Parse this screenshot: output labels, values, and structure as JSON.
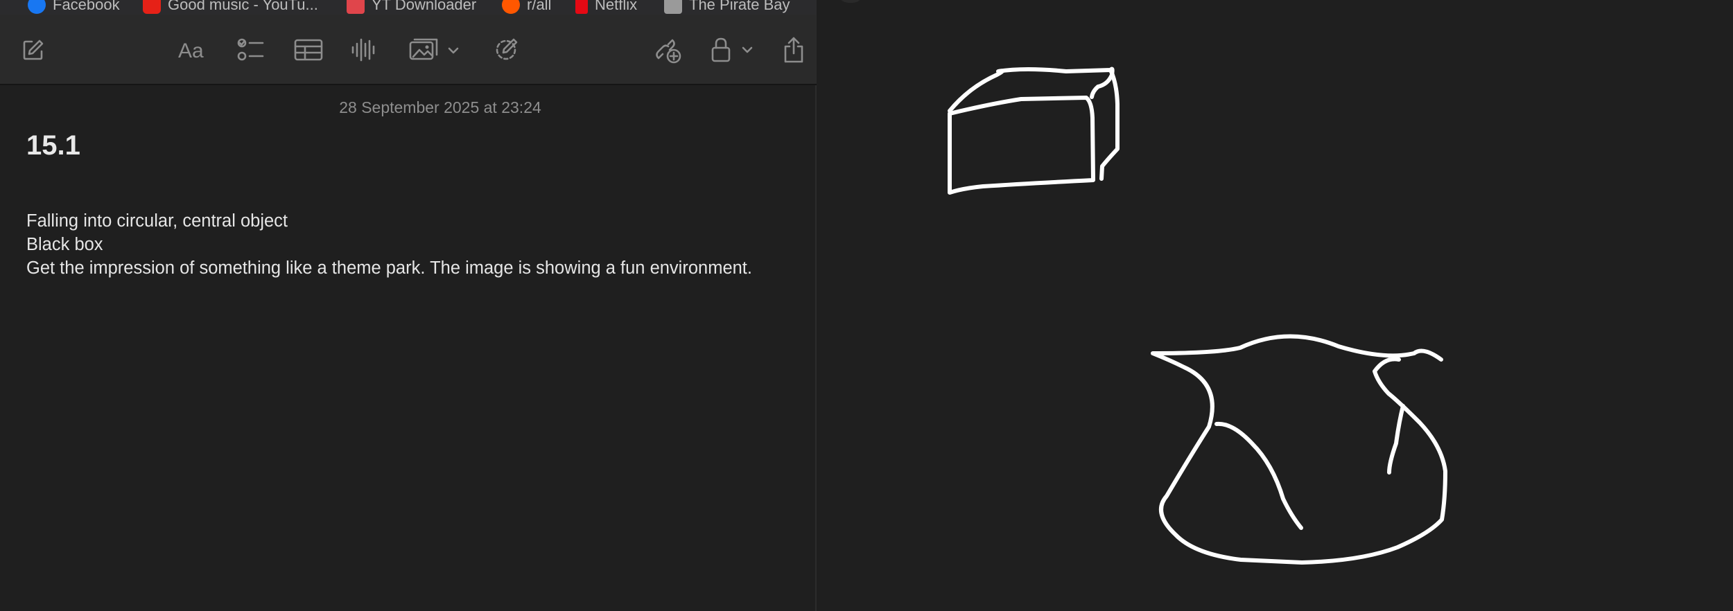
{
  "bookmarks": [
    {
      "label": "Facebook",
      "icon": "facebook-icon",
      "color": "#1877f2"
    },
    {
      "label": "Good music - YouTu...",
      "icon": "youtube-icon",
      "color": "#e62117"
    },
    {
      "label": "YT Downloader",
      "icon": "download-icon",
      "color": "#e0454b"
    },
    {
      "label": "r/all",
      "icon": "reddit-icon",
      "color": "#ff5700"
    },
    {
      "label": "Netflix",
      "icon": "netflix-icon",
      "color": "#e50914"
    },
    {
      "label": "The Pirate Bay",
      "icon": "pirate-bay-icon",
      "color": "#9a9a9a"
    }
  ],
  "toolbar": {
    "icons": [
      "compose-icon",
      "text-format-icon",
      "checklist-icon",
      "table-icon",
      "audio-icon",
      "media-icon",
      "markup-icon",
      "collaborate-icon",
      "lock-icon",
      "share-icon"
    ]
  },
  "note": {
    "date": "28 September 2025 at 23:24",
    "title": "15.1",
    "lines": [
      "Falling into circular, central object",
      "Black box",
      "Get the impression of something like a theme park. The image is showing a fun environment."
    ]
  },
  "colors": {
    "background": "#1f1f1f",
    "toolbar": "#2a2a2a",
    "ink": "#ffffff",
    "text": "#e6e6e6",
    "muted": "#8e8e8e"
  }
}
